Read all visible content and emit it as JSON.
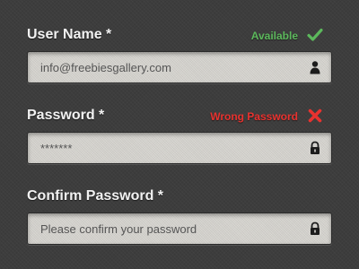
{
  "form": {
    "username": {
      "label": "User Name *",
      "status_text": "Available",
      "status_color": "#5cb85c",
      "status_icon": "checkmark-icon",
      "value": "info@freebiesgallery.com",
      "field_icon": "user-icon"
    },
    "password": {
      "label": "Password *",
      "status_text": "Wrong Password",
      "status_color": "#e8322f",
      "status_icon": "cross-icon",
      "value": "*******",
      "field_icon": "lock-icon"
    },
    "confirm_password": {
      "label": "Confirm Password *",
      "placeholder": "Please confirm your password",
      "field_icon": "lock-icon"
    }
  },
  "colors": {
    "background": "#3d3d3d",
    "input_background": "#d4d2cd",
    "label_text": "#f2f2f2",
    "success": "#5cb85c",
    "error": "#e8322f"
  }
}
